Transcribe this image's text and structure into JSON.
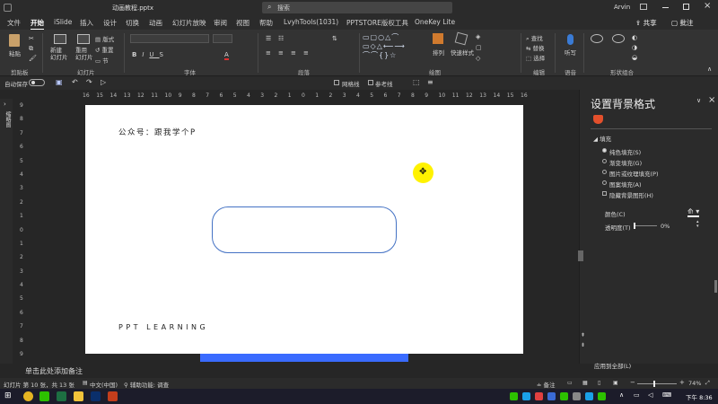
{
  "titlebar": {
    "filename": "动画教程.pptx",
    "search_placeholder": "搜索",
    "user": "Arvin"
  },
  "tabs": [
    "文件",
    "开始",
    "iSlide",
    "插入",
    "设计",
    "切换",
    "动画",
    "幻灯片放映",
    "审阅",
    "视图",
    "帮助",
    "LvyhTools(1031)",
    "PPTSTORE版权工具",
    "OneKey Lite"
  ],
  "tabs_right": {
    "share": "共享",
    "comment": "批注"
  },
  "ribbon": {
    "clipboard": {
      "paste": "粘贴",
      "label": "剪贴板"
    },
    "slides": {
      "new_slide": "新建\n幻灯片",
      "reuse": "重用\n幻灯片",
      "layout": "版式",
      "reset": "重置",
      "section": "节",
      "label": "幻灯片"
    },
    "font": {
      "label": "字体"
    },
    "paragraph": {
      "label": "段落"
    },
    "drawing": {
      "arrange": "排列",
      "quick_styles": "快速样式",
      "label": "绘图"
    },
    "editing": {
      "find": "查找",
      "replace": "替换",
      "select": "选择",
      "label": "编辑"
    },
    "voice": {
      "dictate": "听写",
      "label": "语音"
    },
    "shape_combine": {
      "label": "形状组合"
    }
  },
  "qat": {
    "autosave": "自动保存",
    "gridlines": "网格线",
    "guides": "参考线"
  },
  "ruler_h": [
    "16",
    "15",
    "14",
    "13",
    "12",
    "11",
    "10",
    "9",
    "8",
    "7",
    "6",
    "5",
    "4",
    "3",
    "2",
    "1",
    "0",
    "1",
    "2",
    "3",
    "4",
    "5",
    "6",
    "7",
    "8",
    "9",
    "10",
    "11",
    "12",
    "13",
    "14",
    "15",
    "16"
  ],
  "ruler_v": [
    "9",
    "8",
    "7",
    "6",
    "5",
    "4",
    "3",
    "2",
    "1",
    "0",
    "1",
    "2",
    "3",
    "4",
    "5",
    "6",
    "7",
    "8",
    "9"
  ],
  "left_panel": {
    "label": "缩略图"
  },
  "slide": {
    "header_text": "公众号：跟我学个P",
    "footer_text": "PPT LEARNING"
  },
  "format_pane": {
    "title": "设置背景格式",
    "section": "填充",
    "options": [
      "纯色填充(S)",
      "渐变填充(G)",
      "图片或纹理填充(P)",
      "图案填充(A)"
    ],
    "hide_bg": "隐藏背景图形(H)",
    "color_label": "颜色(C)",
    "transparency_label": "透明度(T)",
    "transparency_value": "0%",
    "transparency_fraction": 0,
    "apply_all": "应用到全部(L)"
  },
  "notes": {
    "placeholder": "单击此处添加备注"
  },
  "status": {
    "slide_info": "幻灯片 第 10 张，共 13 张",
    "language": "中文(中国)",
    "accessibility": "辅助功能: 调查",
    "notes_btn": "备注",
    "zoom": "74%"
  },
  "taskbar": {
    "time": "下午 8:36"
  },
  "colors": {
    "accent_blue": "#3a6bff",
    "shape_border": "#4472c4",
    "cursor_yellow": "#fff200",
    "pptx_red": "#c43e1c"
  }
}
